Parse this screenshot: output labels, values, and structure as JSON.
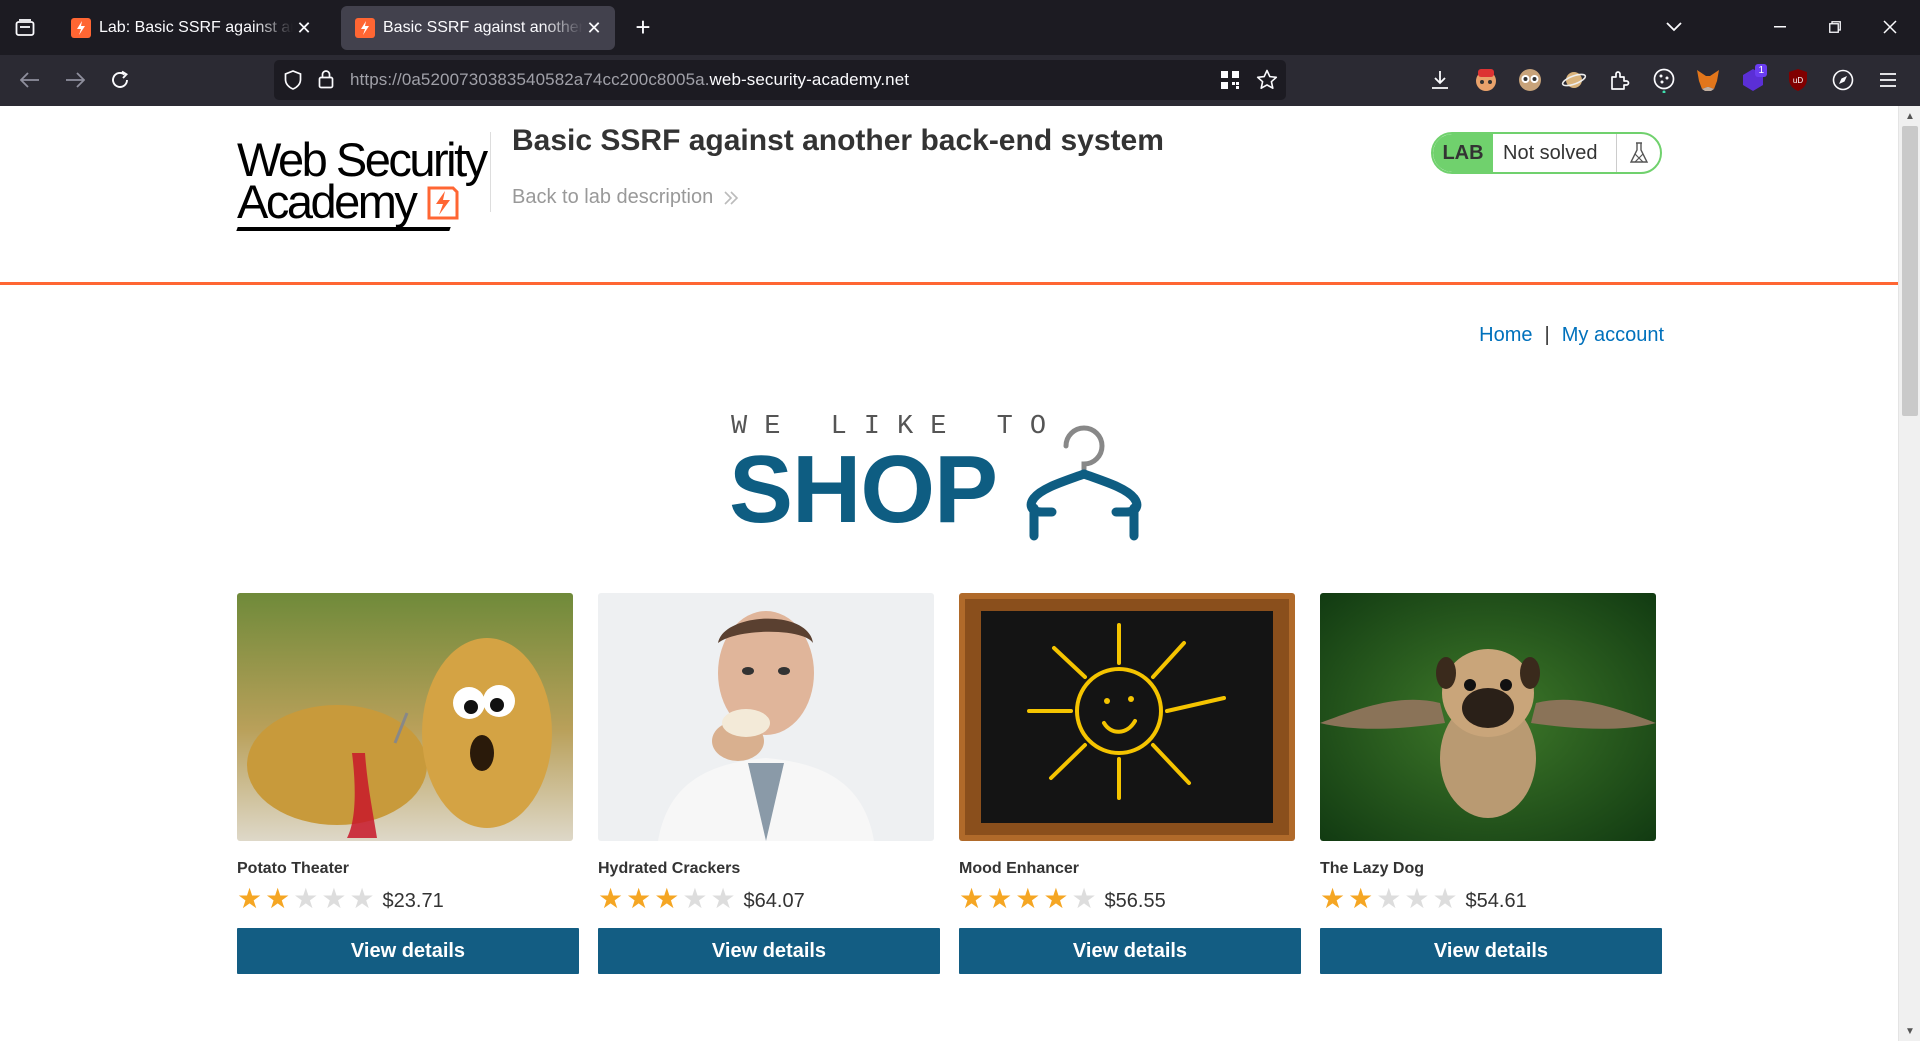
{
  "browser": {
    "tabs": [
      {
        "title": "Lab: Basic SSRF against another back-end system",
        "active": false
      },
      {
        "title": "Basic SSRF against another back-end system",
        "active": true
      }
    ],
    "url_prefix": "https://0a5200730383540582a74cc200c8005a.",
    "url_domain": "web-security-academy.net",
    "icons": {
      "tab_list": "tab-list-icon",
      "new_tab": "plus-icon",
      "back": "arrow-left-icon",
      "forward": "arrow-right-icon",
      "reload": "reload-icon",
      "shield": "tracking-shield-icon",
      "lock": "lock-icon",
      "qr": "qr-code-icon",
      "bookmark": "star-icon",
      "download": "download-icon",
      "menu": "hamburger-menu-icon"
    },
    "extension_badge": "1",
    "colors": {
      "accent": "#ff6633",
      "chrome_dark": "#1c1b22",
      "chrome_mid": "#2b2a33"
    }
  },
  "academy": {
    "logo_line1": "Web Security",
    "logo_line2": "Academy",
    "lab_title": "Basic SSRF against another back-end system",
    "back_link": "Back to lab description",
    "lab_badge": "LAB",
    "lab_status": "Not solved",
    "colors": {
      "accent": "#ff6633",
      "status_green": "#70d16d"
    }
  },
  "nav": {
    "home": "Home",
    "separator": "|",
    "account": "My account",
    "link_color": "#0071bc"
  },
  "banner": {
    "tagline": "WE LIKE TO",
    "headline": "SHOP",
    "color": "#0e5d82"
  },
  "products": [
    {
      "name": "Potato Theater",
      "rating": 2,
      "price": "$23.71",
      "button": "View details"
    },
    {
      "name": "Hydrated Crackers",
      "rating": 3,
      "price": "$64.07",
      "button": "View details"
    },
    {
      "name": "Mood Enhancer",
      "rating": 4,
      "price": "$56.55",
      "button": "View details"
    },
    {
      "name": "The Lazy Dog",
      "rating": 2,
      "price": "$54.61",
      "button": "View details"
    }
  ],
  "rating_max": 5,
  "button_color": "#135d83"
}
